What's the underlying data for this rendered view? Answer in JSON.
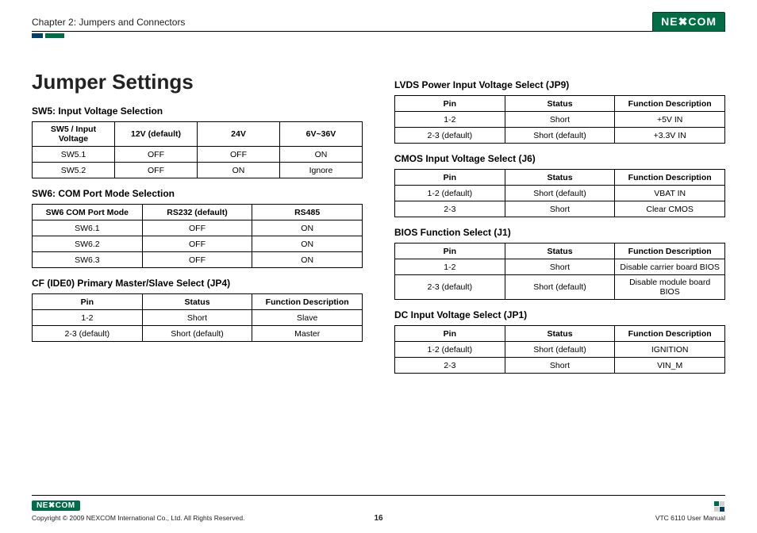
{
  "header": {
    "chapter": "Chapter 2: Jumpers and Connectors",
    "logo": "NE✖COM"
  },
  "main": {
    "title": "Jumper Settings",
    "sw5": {
      "heading": "SW5: Input Voltage Selection",
      "headers": [
        "SW5 / Input Voltage",
        "12V (default)",
        "24V",
        "6V~36V"
      ],
      "rows": [
        [
          "SW5.1",
          "OFF",
          "OFF",
          "ON"
        ],
        [
          "SW5.2",
          "OFF",
          "ON",
          "Ignore"
        ]
      ]
    },
    "sw6": {
      "heading": "SW6: COM Port Mode Selection",
      "headers": [
        "SW6 COM Port Mode",
        "RS232 (default)",
        "RS485"
      ],
      "rows": [
        [
          "SW6.1",
          "OFF",
          "ON"
        ],
        [
          "SW6.2",
          "OFF",
          "ON"
        ],
        [
          "SW6.3",
          "OFF",
          "ON"
        ]
      ]
    },
    "jp4": {
      "heading": "CF (IDE0) Primary Master/Slave Select (JP4)",
      "headers": [
        "Pin",
        "Status",
        "Function Description"
      ],
      "rows": [
        [
          "1-2",
          "Short",
          "Slave"
        ],
        [
          "2-3 (default)",
          "Short (default)",
          "Master"
        ]
      ]
    },
    "jp9": {
      "heading": "LVDS Power Input Voltage Select (JP9)",
      "headers": [
        "Pin",
        "Status",
        "Function Description"
      ],
      "rows": [
        [
          "1-2",
          "Short",
          "+5V IN"
        ],
        [
          "2-3 (default)",
          "Short (default)",
          "+3.3V IN"
        ]
      ]
    },
    "j6": {
      "heading": "CMOS Input Voltage Select (J6)",
      "headers": [
        "Pin",
        "Status",
        "Function Description"
      ],
      "rows": [
        [
          "1-2 (default)",
          "Short (default)",
          "VBAT IN"
        ],
        [
          "2-3",
          "Short",
          "Clear CMOS"
        ]
      ]
    },
    "j1": {
      "heading": "BIOS Function Select (J1)",
      "headers": [
        "Pin",
        "Status",
        "Function Description"
      ],
      "rows": [
        [
          "1-2",
          "Short",
          "Disable carrier board BIOS"
        ],
        [
          "2-3 (default)",
          "Short (default)",
          "Disable module board BIOS"
        ]
      ]
    },
    "jp1": {
      "heading": "DC Input Voltage Select (JP1)",
      "headers": [
        "Pin",
        "Status",
        "Function Description"
      ],
      "rows": [
        [
          "1-2 (default)",
          "Short (default)",
          "IGNITION"
        ],
        [
          "2-3",
          "Short",
          "VIN_M"
        ]
      ]
    }
  },
  "footer": {
    "logo": "NE✖COM",
    "copyright": "Copyright © 2009 NEXCOM International Co., Ltd. All Rights Reserved.",
    "page": "16",
    "manual": "VTC 6110 User Manual"
  }
}
